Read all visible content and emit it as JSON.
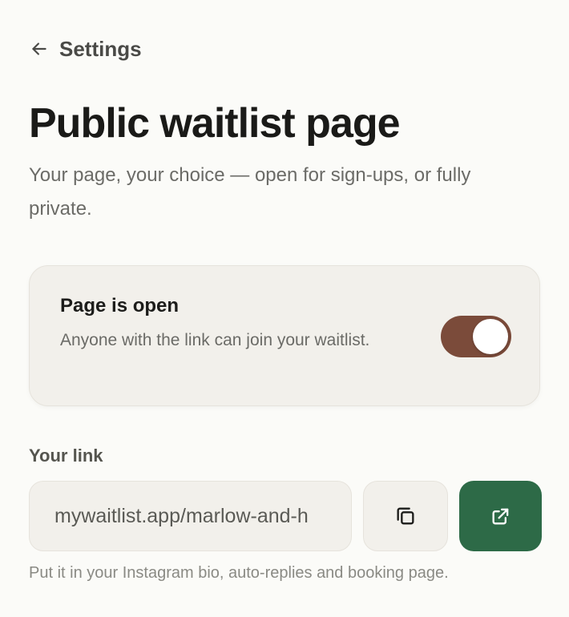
{
  "header": {
    "back_label": "Settings",
    "back_icon": "arrow-left-icon"
  },
  "page": {
    "title": "Public waitlist page",
    "subtitle": "Your page, your choice — open for sign-ups, or fully private."
  },
  "status_card": {
    "title": "Page is open",
    "description": "Anyone with the link can join your waitlist.",
    "toggle_on": true
  },
  "link_section": {
    "label": "Your link",
    "link_value": "mywaitlist.app/marlow-and-h",
    "copy_icon": "copy-icon",
    "open_icon": "external-link-icon",
    "helper": "Put it in your Instagram bio, auto-replies and booking page."
  },
  "colors": {
    "background": "#FBFBF8",
    "card": "#F2F0EB",
    "toggle_on": "#7B4B3A",
    "primary_button": "#2D6A47",
    "muted_text": "#6B6B67"
  }
}
